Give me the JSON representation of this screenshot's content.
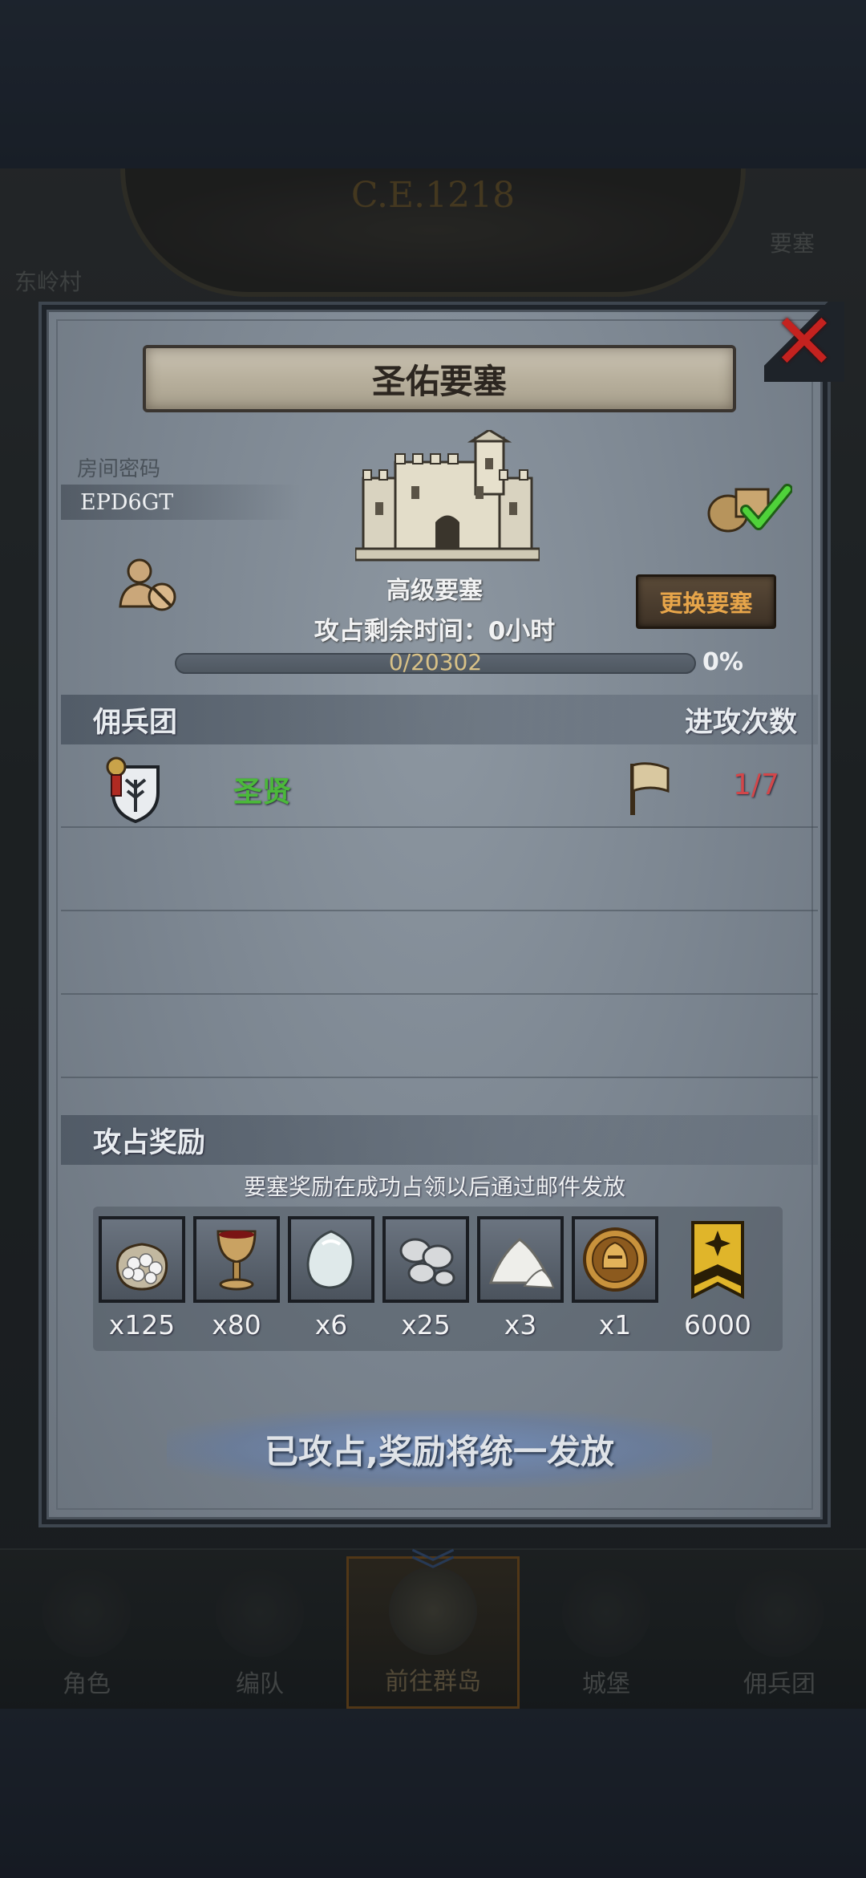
{
  "background": {
    "era": "C.E.1218",
    "side_labels": [
      "东岭村",
      "要塞"
    ]
  },
  "nav": {
    "items": [
      {
        "label": "角色",
        "icon": "knight-icon"
      },
      {
        "label": "编队",
        "icon": "helmet-icon"
      },
      {
        "label": "前往群岛",
        "icon": "globe-icon"
      },
      {
        "label": "城堡",
        "icon": "castle-icon"
      },
      {
        "label": "佣兵团",
        "icon": "warrior-icon"
      }
    ],
    "active_index": 2
  },
  "modal": {
    "title": "圣佑要塞",
    "close_symbol": "✕",
    "room_label": "房间密码",
    "room_code": "EPD6GT",
    "fort_grade": "高级要塞",
    "time_left": "攻占剩余时间：0小时",
    "change_button": "更换要塞",
    "progress": {
      "text": "0/20302",
      "percent_label": "0%",
      "fraction": 0
    },
    "mercenary_header": "佣兵团",
    "attacks_header": "进攻次数",
    "mercenaries": [
      {
        "name": "圣贤",
        "attacks": "1/7"
      }
    ],
    "rewards_header": "攻占奖励",
    "rewards_note": "要塞奖励在成功占领以后通过邮件发放",
    "rewards": [
      {
        "icon": "silver-sack-icon",
        "qty": "x125"
      },
      {
        "icon": "goblet-icon",
        "qty": "x80"
      },
      {
        "icon": "gem-stone-icon",
        "qty": "x6"
      },
      {
        "icon": "silver-coins-icon",
        "qty": "x25"
      },
      {
        "icon": "salt-pile-icon",
        "qty": "x3"
      },
      {
        "icon": "helmet-medal-icon",
        "qty": "x1"
      },
      {
        "icon": "guild-banner-icon",
        "qty": "6000"
      }
    ],
    "claim_button": "已攻占,奖励将统一发放"
  },
  "colors": {
    "accent_gold": "#e7a54a",
    "merc_green": "#4bb83a",
    "count_red": "#d2474a",
    "close_red": "#c4221f"
  }
}
